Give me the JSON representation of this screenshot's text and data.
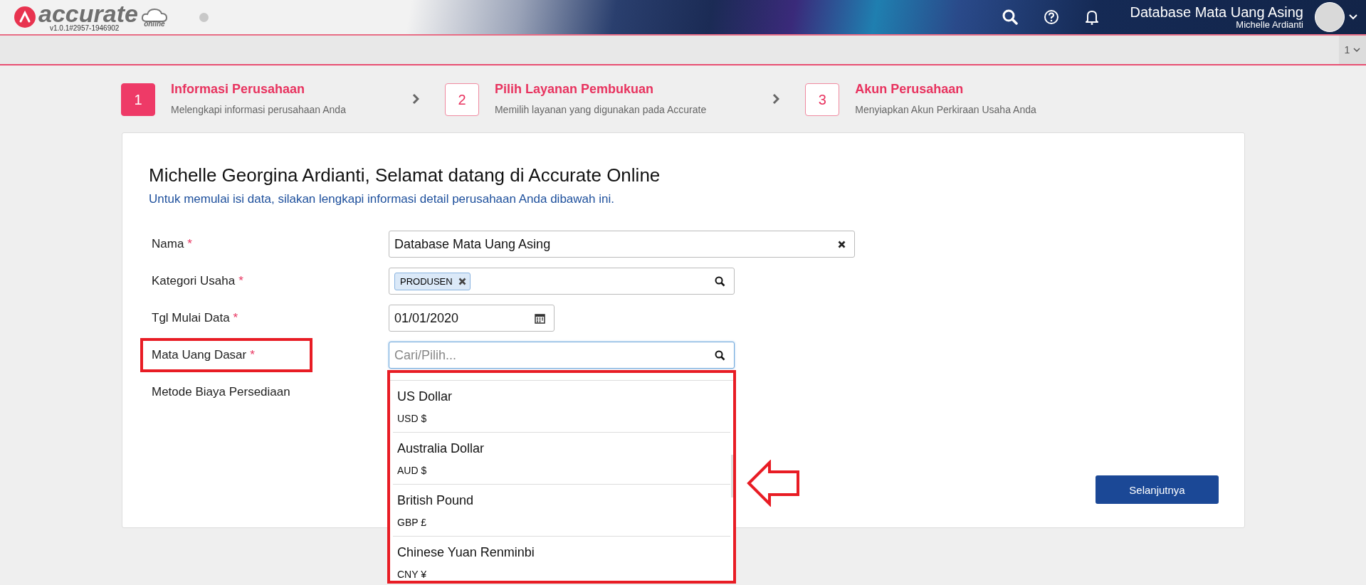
{
  "header": {
    "logo_text": "accurate",
    "logo_sub": "online",
    "version": "v1.0.1#2957-1946902",
    "database": "Database Mata Uang Asing",
    "user": "Michelle Ardianti"
  },
  "subbar": {
    "page_selector": "1"
  },
  "steps": [
    {
      "number": "1",
      "title": "Informasi Perusahaan",
      "caption": "Melengkapi informasi perusahaan Anda",
      "selected": true
    },
    {
      "number": "2",
      "title": "Pilih Layanan Pembukuan",
      "caption": "Memilih layanan yang digunakan pada Accurate",
      "selected": false
    },
    {
      "number": "3",
      "title": "Akun Perusahaan",
      "caption": "Menyiapkan Akun Perkiraan Usaha Anda",
      "selected": false
    }
  ],
  "form": {
    "title": "Michelle Georgina Ardianti, Selamat datang di Accurate Online",
    "subtitle": "Untuk memulai isi data, silakan lengkapi informasi detail perusahaan Anda dibawah ini.",
    "fields": [
      {
        "kind": "text",
        "label": "Nama",
        "required_mark": "*",
        "highlighted": false,
        "value": "Database Mata Uang Asing"
      },
      {
        "kind": "tags",
        "label": "Kategori Usaha",
        "required_mark": "*",
        "highlighted": false,
        "tags": [
          "PRODUSEN"
        ]
      },
      {
        "kind": "date",
        "label": "Tgl Mulai Data",
        "required_mark": "*",
        "highlighted": false,
        "value": "01/01/2020"
      },
      {
        "kind": "search",
        "label": "Mata Uang Dasar",
        "required_mark": "*",
        "highlighted": true,
        "placeholder": "Cari/Pilih..."
      },
      {
        "kind": "none",
        "label": "Metode Biaya Persediaan",
        "highlighted": false
      }
    ],
    "dropdown": {
      "highlighted": true,
      "arrow": true,
      "options": [
        {
          "name": "US Dollar",
          "code": "USD $"
        },
        {
          "name": "Australia Dollar",
          "code": "AUD $"
        },
        {
          "name": "British Pound",
          "code": "GBP £"
        },
        {
          "name": "Chinese Yuan Renminbi",
          "code": "CNY ¥"
        }
      ]
    },
    "next_button": "Selanjutnya"
  }
}
